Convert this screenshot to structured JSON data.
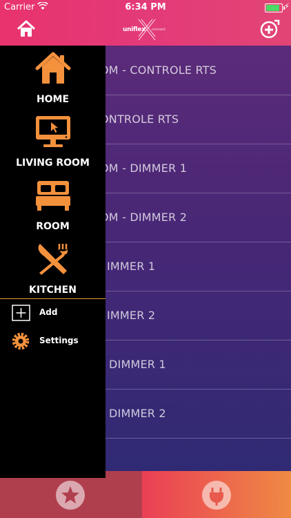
{
  "status_bar": {
    "carrier": "Carrier",
    "time": "6:34 PM"
  },
  "header": {
    "logo_text": "uniflex",
    "logo_subtext": "connect",
    "home_icon": "home-icon",
    "add_icon": "add-circle-icon"
  },
  "drawer": {
    "accent_color": "#f4913d",
    "rooms": [
      {
        "label": "HOME",
        "icon": "house-icon"
      },
      {
        "label": "LIVING ROOM",
        "icon": "tv-icon"
      },
      {
        "label": "ROOM",
        "icon": "bed-icon"
      },
      {
        "label": "KITCHEN",
        "icon": "utensils-icon"
      }
    ],
    "actions": [
      {
        "label": "Add",
        "icon": "add-square-icon"
      },
      {
        "label": "Settings",
        "icon": "gear-icon"
      }
    ]
  },
  "devices": [
    {
      "label": "OM - CONTROLE RTS"
    },
    {
      "label": "ONTROLE RTS"
    },
    {
      "label": "OM - DIMMER 1"
    },
    {
      "label": "OM - DIMMER 2"
    },
    {
      "label": "IMMER 1"
    },
    {
      "label": "IMMER 2"
    },
    {
      "label": "DIMMER 1"
    },
    {
      "label": "DIMMER 2"
    }
  ],
  "bottom_bar": {
    "tabs": [
      {
        "icon": "star-icon"
      },
      {
        "icon": "plug-icon"
      }
    ]
  }
}
